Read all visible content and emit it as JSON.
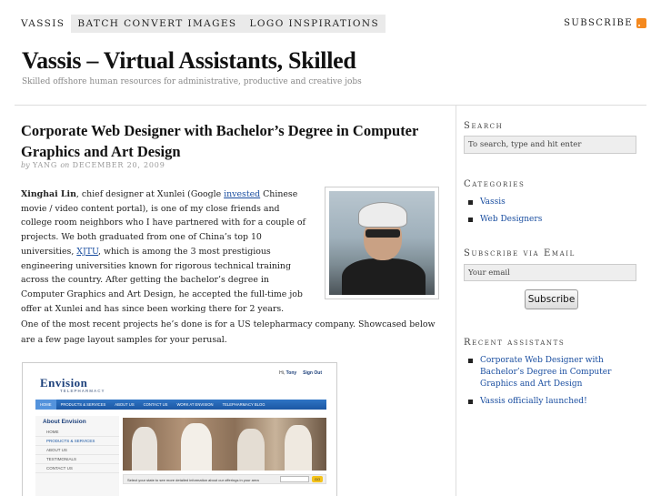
{
  "topnav": {
    "items": [
      "Vassis",
      "Batch Convert Images",
      "Logo Inspirations"
    ],
    "subscribe": "Subscribe"
  },
  "site": {
    "title": "Vassis – Virtual Assistants, Skilled",
    "tagline": "Skilled offshore human resources for administrative, productive and creative jobs"
  },
  "post": {
    "title": "Corporate Web Designer with Bachelor’s Degree in Computer Graphics and Art Design",
    "meta_by": "by",
    "meta_author": "Yang",
    "meta_on": "on",
    "meta_date": "December 20, 2009",
    "p1_name": "Xinghai Lin",
    "p1_a": ", chief designer at Xunlei (Google ",
    "p1_link1": "invested",
    "p1_b": " Chinese movie / video content portal), is one of my close friends and college room neighbors who I have partnered with for a couple of projects. We both graduated from one of China’s top 10 universities, ",
    "p1_link2": "XJTU",
    "p1_c": ", which is among the 3 most prestigious engineering universities known for rigorous technical training across the country. After getting the bachelor’s degree in Computer Graphics and Art Design, he accepted the full-time job offer at Xunlei and has since been working there for 2 years.",
    "p2": "One of the most recent projects he’s done is for a US telepharmacy company. Showcased below are a few page layout samples for your perusal."
  },
  "sample": {
    "logo": "Envision",
    "logo_sub": "TELEPHARMACY",
    "hi": "Hi, ",
    "hi_user": "Tony",
    "signout": "Sign Out",
    "nav": [
      "HOME",
      "PRODUCTS & SERVICES",
      "ABOUT US",
      "CONTACT US",
      "WORK AT ENVISION",
      "TELEPHARMACY BLOG"
    ],
    "side_title": "About Envision",
    "side_items": [
      "HOME",
      "PRODUCTS & SERVICES",
      "ABOUT US",
      "TESTIMONIALS",
      "CONTACT US"
    ],
    "state_text": "Select your state to see more detailed information about our offerings in your area",
    "go": "GO"
  },
  "sidebar": {
    "search_title": "Search",
    "search_placeholder": "To search, type and hit enter",
    "categories_title": "Categories",
    "categories": [
      "Vassis",
      "Web Designers"
    ],
    "email_title": "Subscribe via Email",
    "email_placeholder": "Your email",
    "subscribe_button": "Subscribe",
    "recent_title": "Recent assistants",
    "recent": [
      "Corporate Web Designer with Bachelor’s Degree in Computer Graphics and Art Design",
      "Vassis officially launched!"
    ]
  }
}
